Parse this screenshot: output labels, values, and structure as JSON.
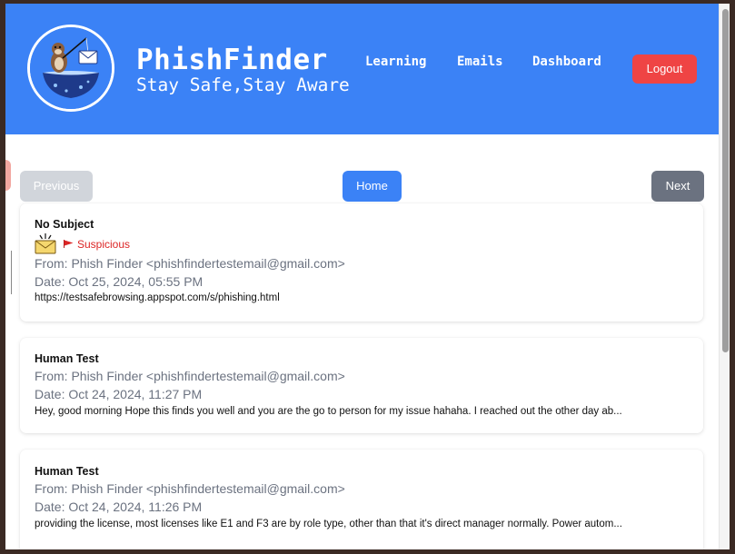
{
  "header": {
    "brand_title": "PhishFinder",
    "brand_tagline": "Stay Safe,Stay Aware",
    "logo_icon": "fishing-otter-envelope-logo",
    "nav": [
      "Learning",
      "Emails",
      "Dashboard"
    ],
    "logout_label": "Logout",
    "colors": {
      "header_bg": "#3b82f6",
      "logout_bg": "#ef4444"
    }
  },
  "pager": {
    "previous_label": "Previous",
    "home_label": "Home",
    "next_label": "Next",
    "previous_disabled": true
  },
  "emails": [
    {
      "subject": "No Subject",
      "suspicious": true,
      "suspicious_label": "Suspicious",
      "badge_icons": [
        "warning-envelope-icon",
        "red-flag-icon"
      ],
      "from": "From: Phish Finder <phishfindertestemail@gmail.com>",
      "date": "Date: Oct 25, 2024, 05:55 PM",
      "snippet": "https://testsafebrowsing.appspot.com/s/phishing.html"
    },
    {
      "subject": "Human Test",
      "suspicious": false,
      "from": "From: Phish Finder <phishfindertestemail@gmail.com>",
      "date": "Date: Oct 24, 2024, 11:27 PM",
      "snippet": "Hey, good morning Hope this finds you well and you are the go to person for my issue hahaha. I reached out the other day ab..."
    },
    {
      "subject": "Human Test",
      "suspicious": false,
      "from": "From: Phish Finder <phishfindertestemail@gmail.com>",
      "date": "Date: Oct 24, 2024, 11:26 PM",
      "snippet": "providing the license, most licenses like E1 and F3 are by role type, other than that it's direct manager normally. Power autom..."
    }
  ],
  "colors": {
    "suspicious_text": "#dc2626",
    "home_button": "#3b82f6",
    "next_button": "#6b7280",
    "previous_button_disabled": "#d1d5db"
  }
}
